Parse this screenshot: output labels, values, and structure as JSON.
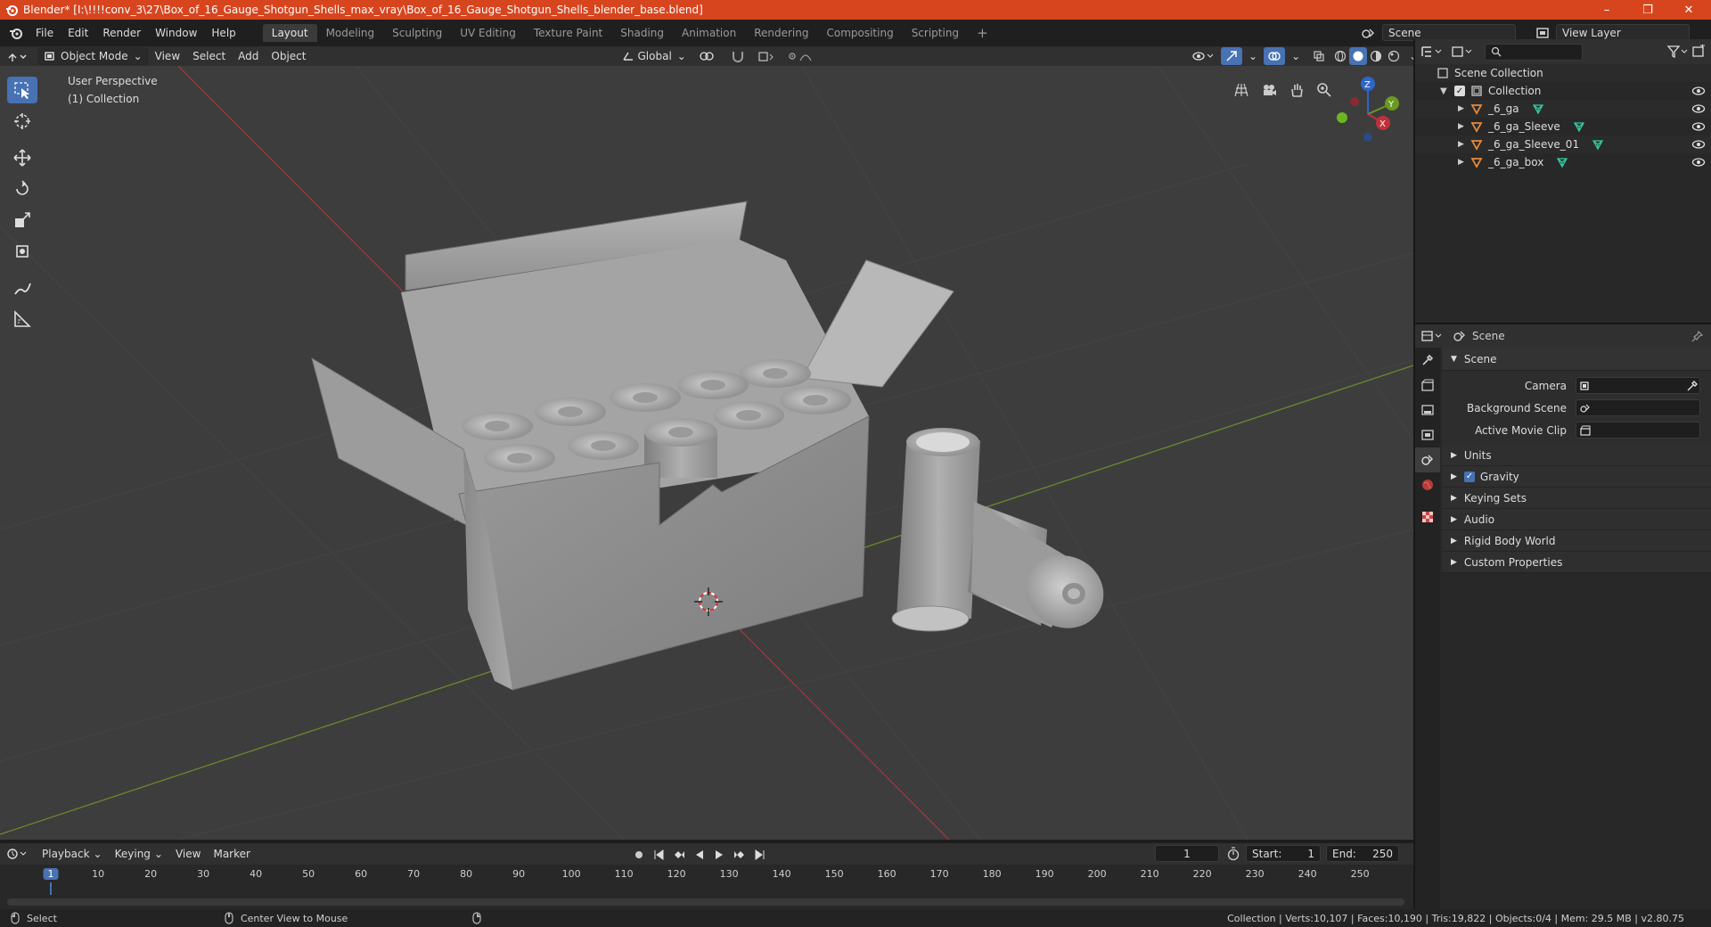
{
  "window": {
    "title": "Blender* [I:\\!!!!conv_3\\27\\Box_of_16_Gauge_Shotgun_Shells_max_vray\\Box_of_16_Gauge_Shotgun_Shells_blender_base.blend]",
    "minimize": "–",
    "maximize": "❐",
    "close": "✕"
  },
  "menu": [
    "File",
    "Edit",
    "Render",
    "Window",
    "Help"
  ],
  "workspaces": [
    "Layout",
    "Modeling",
    "Sculpting",
    "UV Editing",
    "Texture Paint",
    "Shading",
    "Animation",
    "Rendering",
    "Compositing",
    "Scripting"
  ],
  "workspace_add": "+",
  "scene_selector": "Scene",
  "view_layer_selector": "View Layer",
  "viewport_header": {
    "mode": "Object Mode",
    "menus": [
      "View",
      "Select",
      "Add",
      "Object"
    ],
    "orientation": "Global"
  },
  "viewport": {
    "perspective_label": "User Perspective",
    "collection_label": "(1) Collection",
    "gizmo_axes": {
      "x": "X",
      "y": "Y",
      "z": "Z"
    }
  },
  "outliner": {
    "root": "Scene Collection",
    "collection": "Collection",
    "items": [
      "_6_ga",
      "_6_ga_Sleeve",
      "_6_ga_Sleeve_01",
      "_6_ga_box"
    ]
  },
  "properties": {
    "header": "Scene",
    "section": "Scene",
    "fields": [
      {
        "label": "Camera",
        "value": ""
      },
      {
        "label": "Background Scene",
        "value": ""
      },
      {
        "label": "Active Movie Clip",
        "value": ""
      }
    ],
    "panels": [
      "Units",
      "Gravity",
      "Keying Sets",
      "Audio",
      "Rigid Body World",
      "Custom Properties"
    ],
    "gravity_checked": true
  },
  "timeline": {
    "menus": [
      "Playback",
      "Keying",
      "View",
      "Marker"
    ],
    "current_frame": "1",
    "start_label": "Start:",
    "start": "1",
    "end_label": "End:",
    "end": "250",
    "ruler": [
      "1",
      "10",
      "20",
      "30",
      "40",
      "50",
      "60",
      "70",
      "80",
      "90",
      "100",
      "110",
      "120",
      "130",
      "140",
      "150",
      "160",
      "170",
      "180",
      "190",
      "200",
      "210",
      "220",
      "230",
      "240",
      "250"
    ]
  },
  "status": {
    "left": "Select",
    "middle": "Center View to Mouse",
    "right": "Collection | Verts:10,107 | Faces:10,190 | Tris:19,822 | Objects:0/4 | Mem: 29.5 MB | v2.80.75"
  },
  "colors": {
    "titlebar": "#d7451f",
    "accent": "#4772b3",
    "grid_x": "#9a3a3a",
    "grid_y": "#6a8a2a"
  }
}
